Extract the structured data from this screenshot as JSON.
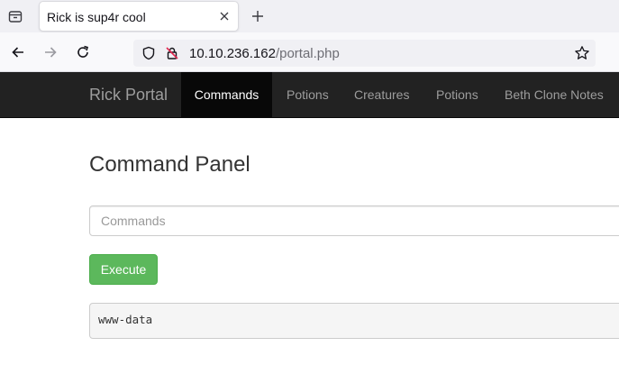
{
  "browser": {
    "tab": {
      "title": "Rick is sup4r cool"
    },
    "url": {
      "host": "10.10.236.162",
      "path": "/portal.php"
    },
    "icons": {
      "tab_list": "tab-list-icon",
      "close": "close-icon",
      "new_tab": "plus-icon",
      "back": "arrow-left-icon",
      "forward": "arrow-right-icon",
      "reload": "reload-icon",
      "tracking": "shield-icon",
      "insecure": "insecure-lock-icon",
      "bookmark": "star-icon"
    }
  },
  "site": {
    "brand": "Rick Portal",
    "nav": [
      {
        "label": "Commands",
        "active": true
      },
      {
        "label": "Potions",
        "active": false
      },
      {
        "label": "Creatures",
        "active": false
      },
      {
        "label": "Potions",
        "active": false
      },
      {
        "label": "Beth Clone Notes",
        "active": false
      }
    ],
    "colors": {
      "navbar": "#222222",
      "active_nav": "#080808",
      "execute_button": "#5cb85c"
    }
  },
  "main": {
    "title": "Command Panel",
    "input": {
      "placeholder": "Commands",
      "value": ""
    },
    "execute_label": "Execute",
    "output": "www-data"
  }
}
